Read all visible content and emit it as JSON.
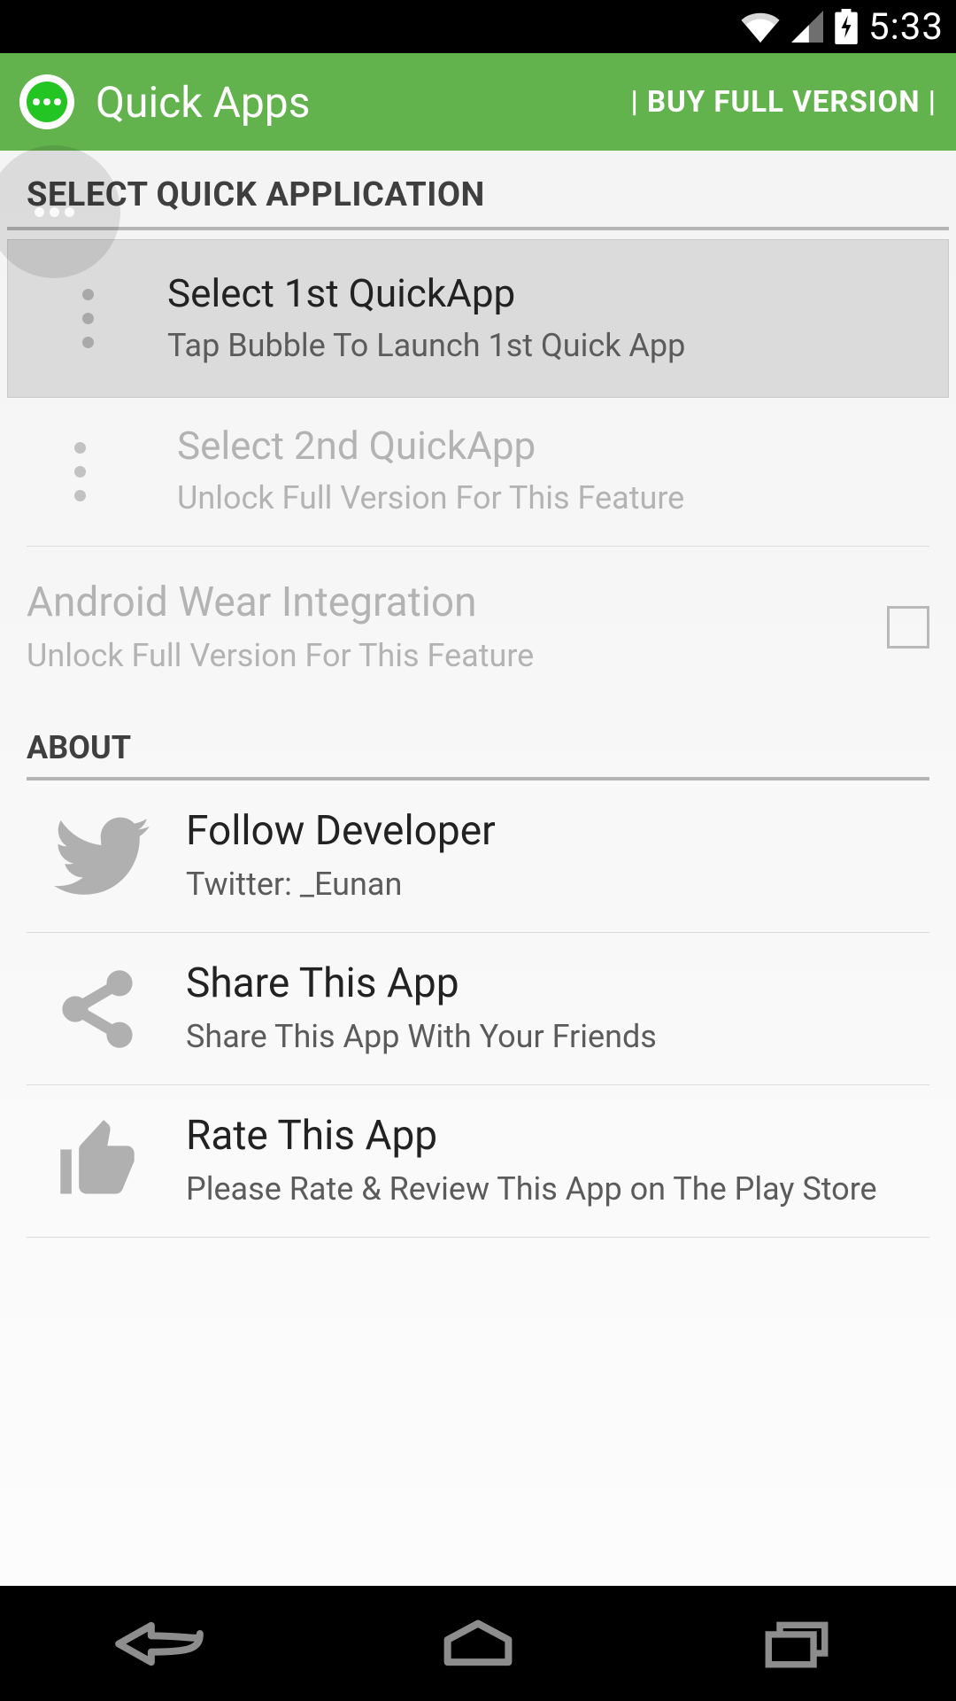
{
  "statusbar": {
    "time": "5:33"
  },
  "header": {
    "title": "Quick Apps",
    "buy_full": "| BUY FULL VERSION |"
  },
  "sections": {
    "select_app": {
      "header": "SELECT QUICK APPLICATION",
      "item1": {
        "title": "Select 1st QuickApp",
        "sub": "Tap Bubble To Launch 1st Quick App"
      },
      "item2": {
        "title": "Select 2nd QuickApp",
        "sub": "Unlock Full Version For This Feature"
      },
      "wear": {
        "title": "Android Wear Integration",
        "sub": "Unlock Full Version For This Feature"
      }
    },
    "about": {
      "header": "ABOUT",
      "follow": {
        "title": "Follow Developer",
        "sub": "Twitter: _Eunan"
      },
      "share": {
        "title": "Share This App",
        "sub": "Share This App With Your Friends"
      },
      "rate": {
        "title": "Rate This App",
        "sub": "Please Rate & Review This App on The Play Store"
      }
    }
  }
}
